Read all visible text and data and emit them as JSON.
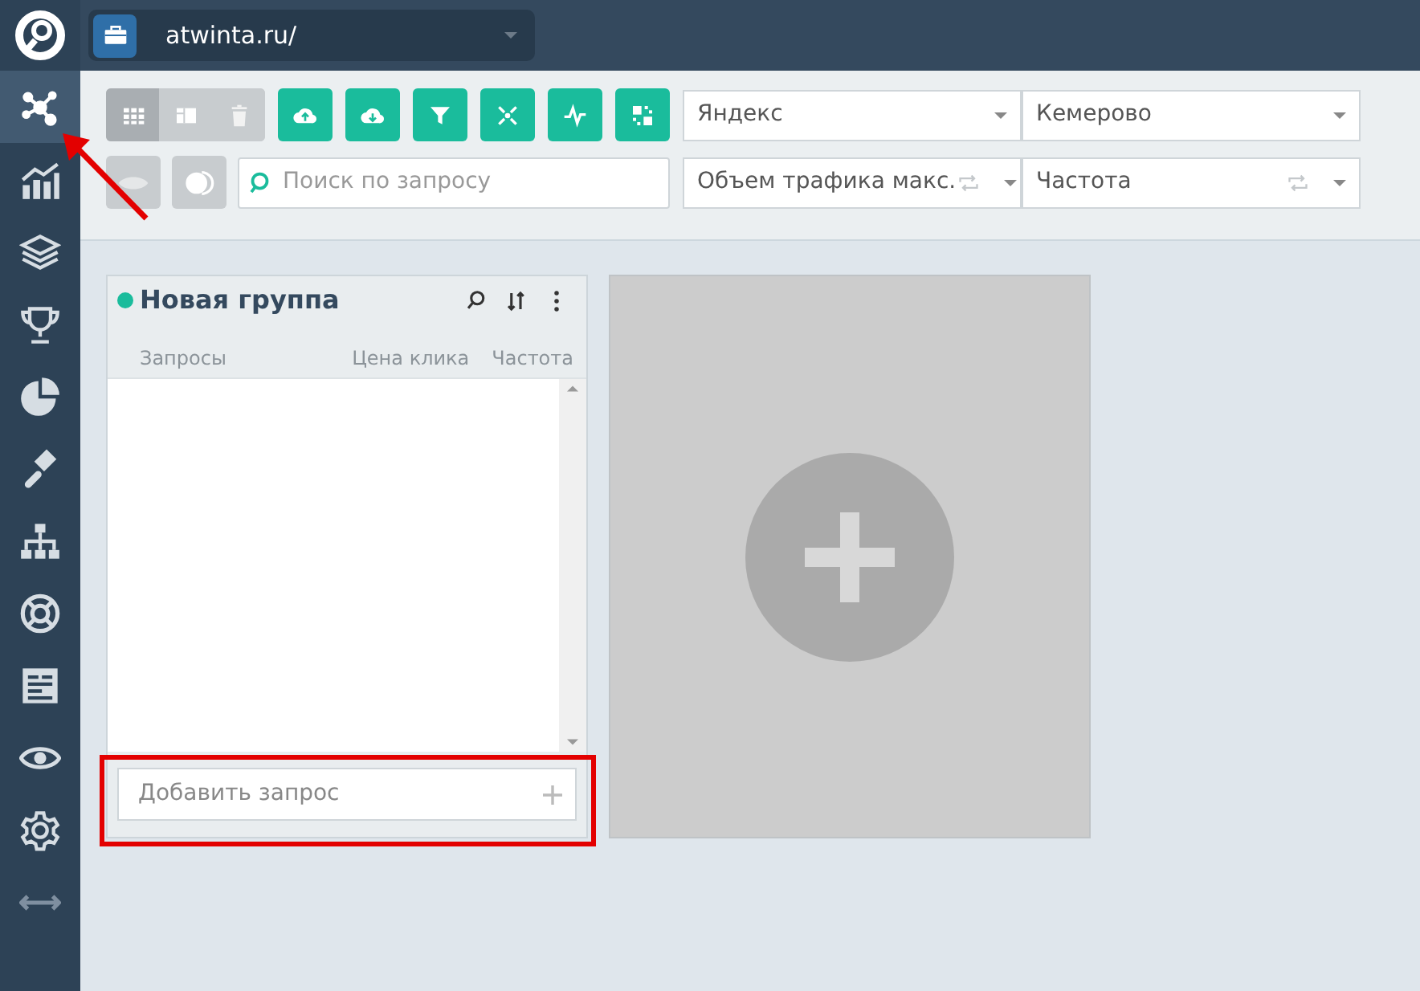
{
  "sidebar": {
    "items": [
      {
        "kind": "network",
        "selected": true
      },
      {
        "kind": "chart",
        "selected": false
      },
      {
        "kind": "layers",
        "selected": false
      },
      {
        "kind": "trophy",
        "selected": false
      },
      {
        "kind": "pie",
        "selected": false
      },
      {
        "kind": "gavel",
        "selected": false
      },
      {
        "kind": "sitemap",
        "selected": false
      },
      {
        "kind": "lifebuoy",
        "selected": false
      },
      {
        "kind": "report",
        "selected": false
      },
      {
        "kind": "eye",
        "selected": false
      },
      {
        "kind": "gear",
        "selected": false
      },
      {
        "kind": "resize",
        "selected": false
      }
    ]
  },
  "project": {
    "name": "atwinta.ru/"
  },
  "toolbar": {
    "view_buttons": [
      {
        "kind": "grid",
        "selected": true
      },
      {
        "kind": "columns",
        "selected": false
      },
      {
        "kind": "trash",
        "selected": false
      }
    ],
    "action_buttons": [
      {
        "kind": "upload"
      },
      {
        "kind": "download"
      },
      {
        "kind": "filter"
      },
      {
        "kind": "expand"
      },
      {
        "kind": "pulse"
      },
      {
        "kind": "qr"
      }
    ],
    "toggles": [
      {
        "kind": "eye"
      },
      {
        "kind": "contrast"
      }
    ],
    "search": {
      "placeholder": "Поиск по запросу"
    },
    "selects": [
      {
        "value": "Яндекс",
        "refresh": false
      },
      {
        "value": "Кемерово",
        "refresh": false
      },
      {
        "value": "Объем трафика макс.",
        "refresh": true
      },
      {
        "value": "Частота",
        "refresh": true
      }
    ]
  },
  "group": {
    "title": "Новая группа",
    "color": "#1abc9c",
    "columns": [
      "Запросы",
      "Цена клика",
      "Частота"
    ],
    "add_field": {
      "placeholder": "Добавить запрос"
    }
  }
}
